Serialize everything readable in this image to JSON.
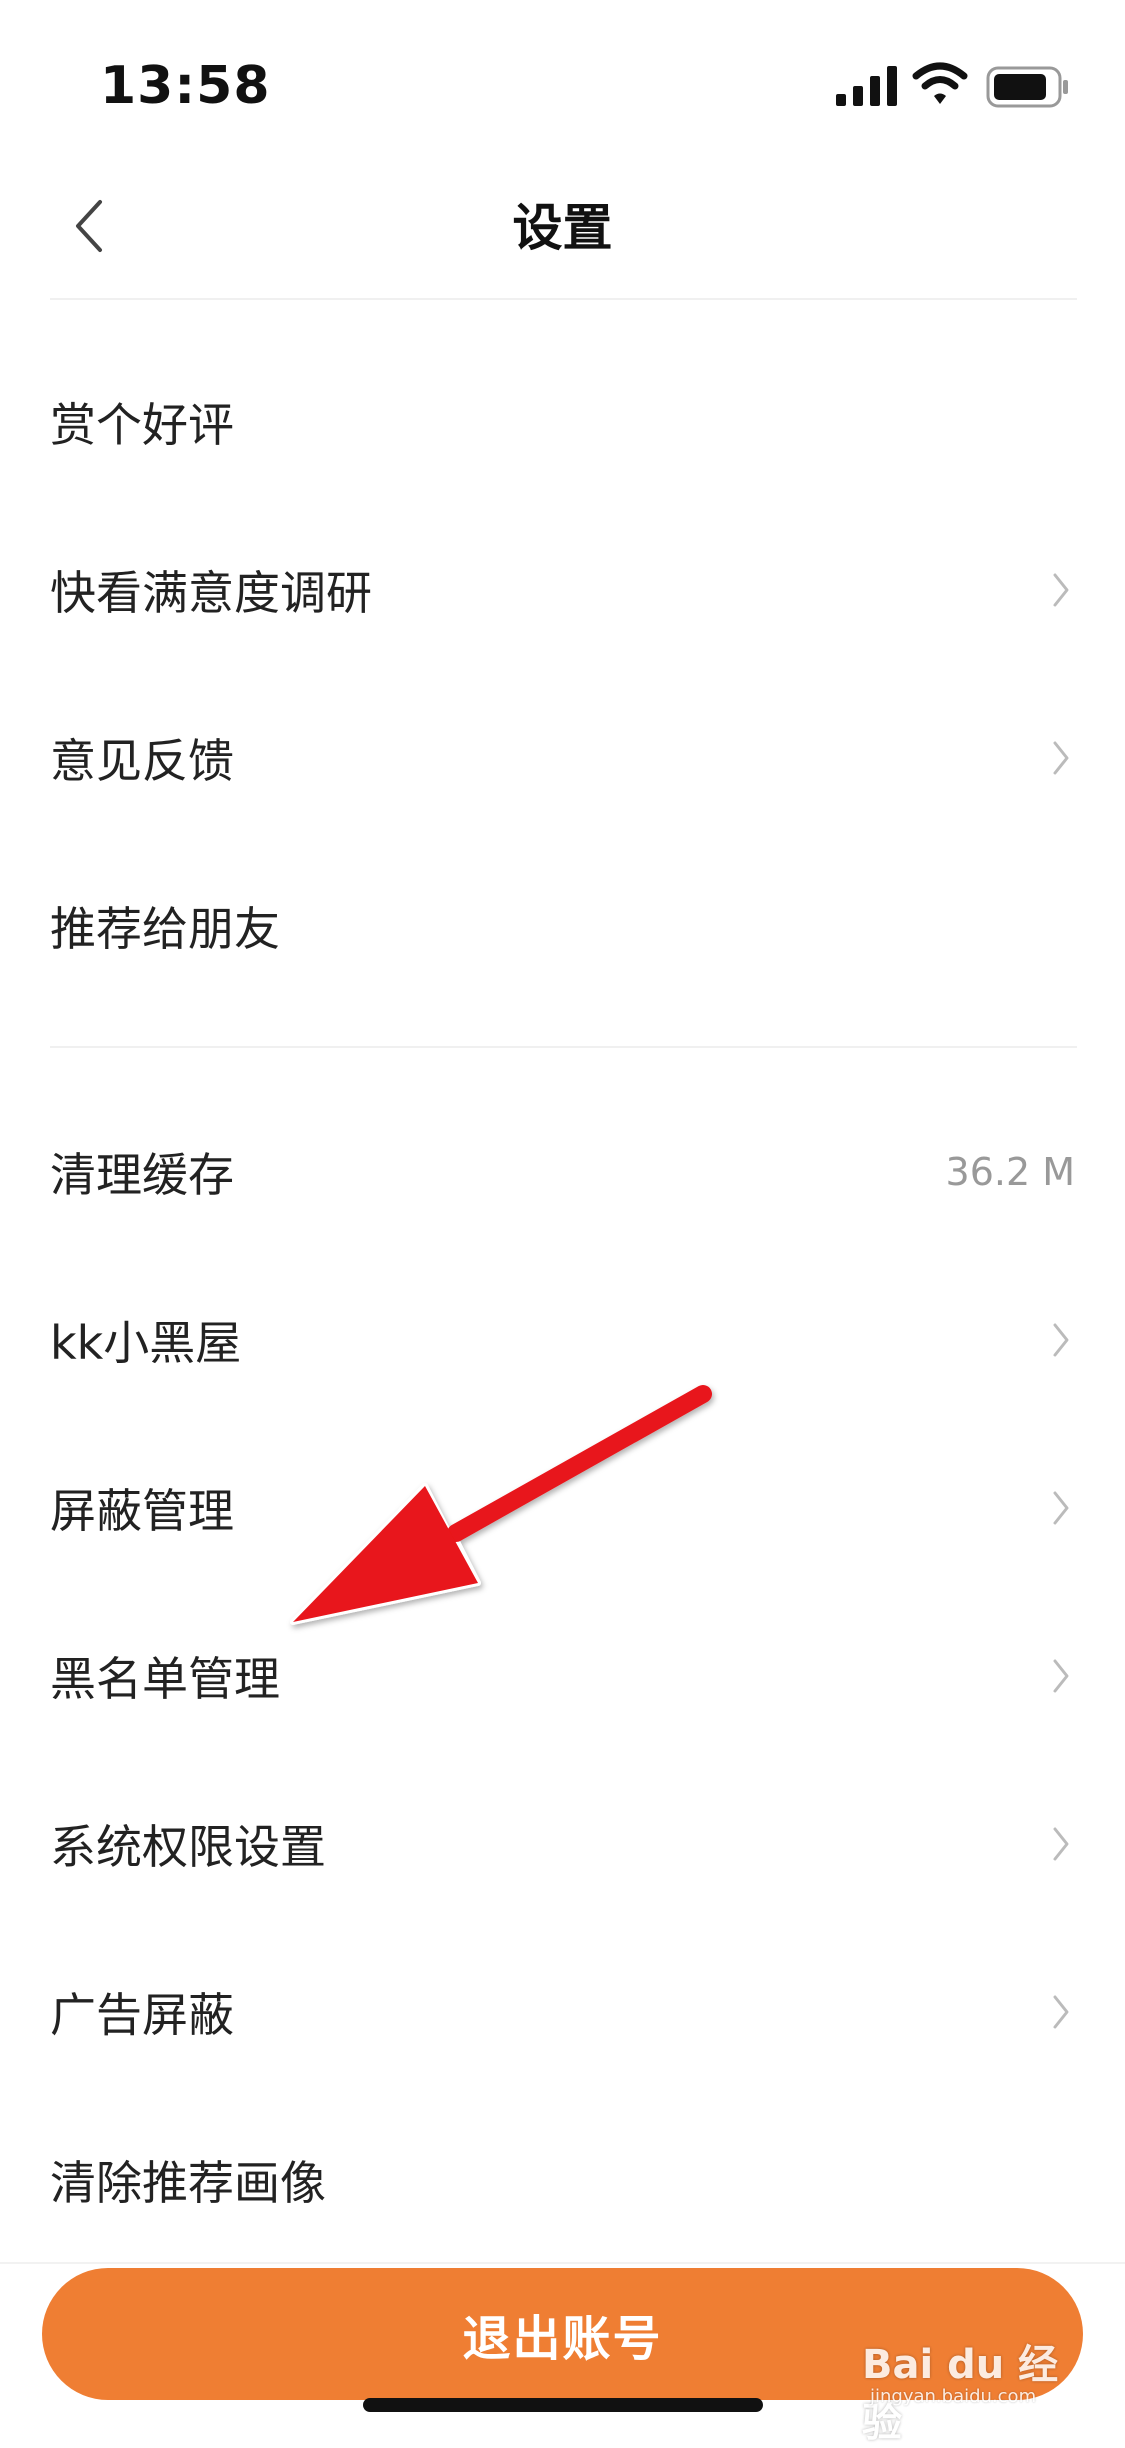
{
  "status_bar": {
    "time": "13:58",
    "icons": [
      "signal-icon",
      "wifi-icon",
      "battery-icon"
    ]
  },
  "nav": {
    "title": "设置",
    "back_icon": "chevron-left-icon"
  },
  "sections": [
    {
      "items": [
        {
          "label": "赏个好评",
          "chevron": false
        },
        {
          "label": "快看满意度调研",
          "chevron": true
        },
        {
          "label": "意见反馈",
          "chevron": true
        },
        {
          "label": "推荐给朋友",
          "chevron": false
        }
      ]
    },
    {
      "items": [
        {
          "label": "清理缓存",
          "value": "36.2 M",
          "chevron": false
        },
        {
          "label": "kk小黑屋",
          "chevron": true
        },
        {
          "label": "屏蔽管理",
          "chevron": true
        },
        {
          "label": "黑名单管理",
          "chevron": true
        },
        {
          "label": "系统权限设置",
          "chevron": true
        },
        {
          "label": "广告屏蔽",
          "chevron": true
        },
        {
          "label": "清除推荐画像",
          "chevron": false
        }
      ]
    }
  ],
  "logout_button": {
    "label": "退出账号"
  },
  "watermark": {
    "text": "Bai du 经验",
    "sub": "jingyan.baidu.com"
  },
  "colors": {
    "accent": "#ef7e33",
    "annotation_arrow": "#e8141a",
    "text": "#222222",
    "muted": "#999999",
    "divider": "#f0f0f0"
  }
}
